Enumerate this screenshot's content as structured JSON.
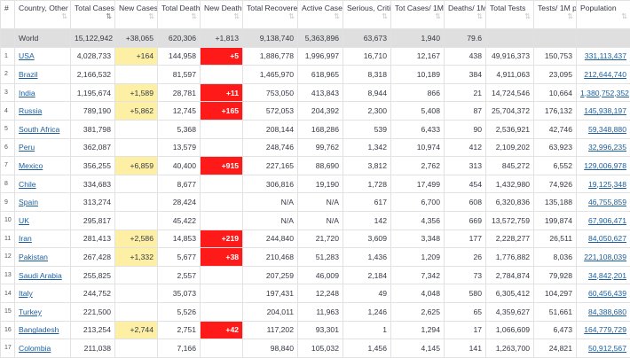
{
  "headers": [
    {
      "label": "#",
      "sort": false
    },
    {
      "label": "Country, Other",
      "sort": true
    },
    {
      "label": "Total Cases",
      "sort": true,
      "active": true
    },
    {
      "label": "New Cases",
      "sort": true
    },
    {
      "label": "Total Deaths",
      "sort": true
    },
    {
      "label": "New Deaths",
      "sort": true
    },
    {
      "label": "Total Recovered",
      "sort": true
    },
    {
      "label": "Active Cases",
      "sort": true
    },
    {
      "label": "Serious, Critical",
      "sort": true
    },
    {
      "label": "Tot Cases/ 1M pop",
      "sort": true
    },
    {
      "label": "Deaths/ 1M pop",
      "sort": true
    },
    {
      "label": "Total Tests",
      "sort": true
    },
    {
      "label": "Tests/ 1M pop",
      "sort": true
    },
    {
      "label": "Population",
      "sort": true
    }
  ],
  "sort_icon": "⇅",
  "world": {
    "idx": "",
    "country": "World",
    "total_cases": "15,122,942",
    "new_cases": "+38,065",
    "total_deaths": "620,306",
    "new_deaths": "+1,813",
    "total_recovered": "9,138,740",
    "active_cases": "5,363,896",
    "serious": "63,673",
    "cases_per_m": "1,940",
    "deaths_per_m": "79.6",
    "total_tests": "",
    "tests_per_m": "",
    "population": ""
  },
  "rows": [
    {
      "idx": "1",
      "country": "USA",
      "total_cases": "4,028,733",
      "new_cases": "+164",
      "total_deaths": "144,958",
      "new_deaths": "+5",
      "total_recovered": "1,886,778",
      "active_cases": "1,996,997",
      "serious": "16,710",
      "cases_per_m": "12,167",
      "deaths_per_m": "438",
      "total_tests": "49,916,373",
      "tests_per_m": "150,753",
      "population": "331,113,437"
    },
    {
      "idx": "2",
      "country": "Brazil",
      "total_cases": "2,166,532",
      "new_cases": "",
      "total_deaths": "81,597",
      "new_deaths": "",
      "total_recovered": "1,465,970",
      "active_cases": "618,965",
      "serious": "8,318",
      "cases_per_m": "10,189",
      "deaths_per_m": "384",
      "total_tests": "4,911,063",
      "tests_per_m": "23,095",
      "population": "212,644,740"
    },
    {
      "idx": "3",
      "country": "India",
      "total_cases": "1,195,674",
      "new_cases": "+1,589",
      "total_deaths": "28,781",
      "new_deaths": "+11",
      "total_recovered": "753,050",
      "active_cases": "413,843",
      "serious": "8,944",
      "cases_per_m": "866",
      "deaths_per_m": "21",
      "total_tests": "14,724,546",
      "tests_per_m": "10,664",
      "population": "1,380,752,352"
    },
    {
      "idx": "4",
      "country": "Russia",
      "total_cases": "789,190",
      "new_cases": "+5,862",
      "total_deaths": "12,745",
      "new_deaths": "+165",
      "total_recovered": "572,053",
      "active_cases": "204,392",
      "serious": "2,300",
      "cases_per_m": "5,408",
      "deaths_per_m": "87",
      "total_tests": "25,704,372",
      "tests_per_m": "176,132",
      "population": "145,938,197"
    },
    {
      "idx": "5",
      "country": "South Africa",
      "total_cases": "381,798",
      "new_cases": "",
      "total_deaths": "5,368",
      "new_deaths": "",
      "total_recovered": "208,144",
      "active_cases": "168,286",
      "serious": "539",
      "cases_per_m": "6,433",
      "deaths_per_m": "90",
      "total_tests": "2,536,921",
      "tests_per_m": "42,746",
      "population": "59,348,880"
    },
    {
      "idx": "6",
      "country": "Peru",
      "total_cases": "362,087",
      "new_cases": "",
      "total_deaths": "13,579",
      "new_deaths": "",
      "total_recovered": "248,746",
      "active_cases": "99,762",
      "serious": "1,342",
      "cases_per_m": "10,974",
      "deaths_per_m": "412",
      "total_tests": "2,109,202",
      "tests_per_m": "63,923",
      "population": "32,996,235"
    },
    {
      "idx": "7",
      "country": "Mexico",
      "total_cases": "356,255",
      "new_cases": "+6,859",
      "total_deaths": "40,400",
      "new_deaths": "+915",
      "total_recovered": "227,165",
      "active_cases": "88,690",
      "serious": "3,812",
      "cases_per_m": "2,762",
      "deaths_per_m": "313",
      "total_tests": "845,272",
      "tests_per_m": "6,552",
      "population": "129,006,978"
    },
    {
      "idx": "8",
      "country": "Chile",
      "total_cases": "334,683",
      "new_cases": "",
      "total_deaths": "8,677",
      "new_deaths": "",
      "total_recovered": "306,816",
      "active_cases": "19,190",
      "serious": "1,728",
      "cases_per_m": "17,499",
      "deaths_per_m": "454",
      "total_tests": "1,432,980",
      "tests_per_m": "74,926",
      "population": "19,125,348"
    },
    {
      "idx": "9",
      "country": "Spain",
      "total_cases": "313,274",
      "new_cases": "",
      "total_deaths": "28,424",
      "new_deaths": "",
      "total_recovered": "N/A",
      "active_cases": "N/A",
      "serious": "617",
      "cases_per_m": "6,700",
      "deaths_per_m": "608",
      "total_tests": "6,320,836",
      "tests_per_m": "135,188",
      "population": "46,755,859"
    },
    {
      "idx": "10",
      "country": "UK",
      "total_cases": "295,817",
      "new_cases": "",
      "total_deaths": "45,422",
      "new_deaths": "",
      "total_recovered": "N/A",
      "active_cases": "N/A",
      "serious": "142",
      "cases_per_m": "4,356",
      "deaths_per_m": "669",
      "total_tests": "13,572,759",
      "tests_per_m": "199,874",
      "population": "67,906,471"
    },
    {
      "idx": "11",
      "country": "Iran",
      "total_cases": "281,413",
      "new_cases": "+2,586",
      "total_deaths": "14,853",
      "new_deaths": "+219",
      "total_recovered": "244,840",
      "active_cases": "21,720",
      "serious": "3,609",
      "cases_per_m": "3,348",
      "deaths_per_m": "177",
      "total_tests": "2,228,277",
      "tests_per_m": "26,511",
      "population": "84,050,627"
    },
    {
      "idx": "12",
      "country": "Pakistan",
      "total_cases": "267,428",
      "new_cases": "+1,332",
      "total_deaths": "5,677",
      "new_deaths": "+38",
      "total_recovered": "210,468",
      "active_cases": "51,283",
      "serious": "1,436",
      "cases_per_m": "1,209",
      "deaths_per_m": "26",
      "total_tests": "1,776,882",
      "tests_per_m": "8,036",
      "population": "221,108,039"
    },
    {
      "idx": "13",
      "country": "Saudi Arabia",
      "total_cases": "255,825",
      "new_cases": "",
      "total_deaths": "2,557",
      "new_deaths": "",
      "total_recovered": "207,259",
      "active_cases": "46,009",
      "serious": "2,184",
      "cases_per_m": "7,342",
      "deaths_per_m": "73",
      "total_tests": "2,784,874",
      "tests_per_m": "79,928",
      "population": "34,842,201"
    },
    {
      "idx": "14",
      "country": "Italy",
      "total_cases": "244,752",
      "new_cases": "",
      "total_deaths": "35,073",
      "new_deaths": "",
      "total_recovered": "197,431",
      "active_cases": "12,248",
      "serious": "49",
      "cases_per_m": "4,048",
      "deaths_per_m": "580",
      "total_tests": "6,305,412",
      "tests_per_m": "104,297",
      "population": "60,456,439"
    },
    {
      "idx": "15",
      "country": "Turkey",
      "total_cases": "221,500",
      "new_cases": "",
      "total_deaths": "5,526",
      "new_deaths": "",
      "total_recovered": "204,011",
      "active_cases": "11,963",
      "serious": "1,246",
      "cases_per_m": "2,625",
      "deaths_per_m": "65",
      "total_tests": "4,359,627",
      "tests_per_m": "51,661",
      "population": "84,388,680"
    },
    {
      "idx": "16",
      "country": "Bangladesh",
      "total_cases": "213,254",
      "new_cases": "+2,744",
      "total_deaths": "2,751",
      "new_deaths": "+42",
      "total_recovered": "117,202",
      "active_cases": "93,301",
      "serious": "1",
      "cases_per_m": "1,294",
      "deaths_per_m": "17",
      "total_tests": "1,066,609",
      "tests_per_m": "6,473",
      "population": "164,779,729"
    },
    {
      "idx": "17",
      "country": "Colombia",
      "total_cases": "211,038",
      "new_cases": "",
      "total_deaths": "7,166",
      "new_deaths": "",
      "total_recovered": "98,840",
      "active_cases": "105,032",
      "serious": "1,456",
      "cases_per_m": "4,145",
      "deaths_per_m": "141",
      "total_tests": "1,263,700",
      "tests_per_m": "24,821",
      "population": "50,912,567"
    }
  ],
  "colors": {
    "new_cases_bg": "#fdf0a5",
    "new_deaths_bg": "#ff1a1a",
    "world_bg": "#dfdfdf",
    "link": "#1b5e9e"
  }
}
